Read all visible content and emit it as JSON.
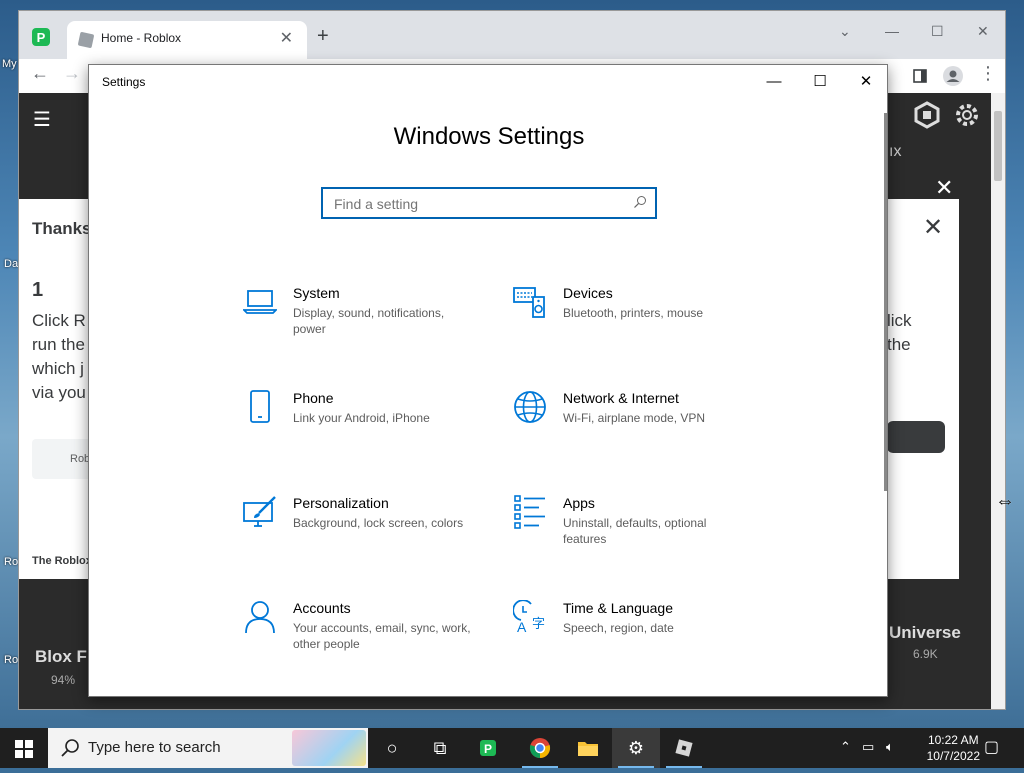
{
  "desktop": {
    "labels": [
      "My",
      "Da",
      "Ro",
      "Ro"
    ]
  },
  "chrome": {
    "tab_title": "Home - Roblox",
    "new_tab": "+",
    "back": "←",
    "forward": "→"
  },
  "roblox_page": {
    "modal_title_partial": "Thanks",
    "step_number": "1",
    "text_lines": [
      "Click R",
      "run the",
      "which j",
      "via you"
    ],
    "right_lines": [
      "lick",
      "the"
    ],
    "roblox_chip": "Robl",
    "footer_partial": "The Roblox",
    "game_title_partial": "Blox F",
    "game_rating_partial": "94%",
    "right_game_title": "Universe",
    "right_game_stat": "6.9K",
    "bx_partial": "ıx"
  },
  "settings": {
    "window_title": "Settings",
    "minimize": "—",
    "maximize": "☐",
    "close": "✕",
    "heading": "Windows Settings",
    "search_placeholder": "Find a setting",
    "items": [
      {
        "title": "System",
        "desc": "Display, sound, notifications, power"
      },
      {
        "title": "Devices",
        "desc": "Bluetooth, printers, mouse"
      },
      {
        "title": "Phone",
        "desc": "Link your Android, iPhone"
      },
      {
        "title": "Network & Internet",
        "desc": "Wi-Fi, airplane mode, VPN"
      },
      {
        "title": "Personalization",
        "desc": "Background, lock screen, colors"
      },
      {
        "title": "Apps",
        "desc": "Uninstall, defaults, optional features"
      },
      {
        "title": "Accounts",
        "desc": "Your accounts, email, sync, work, other people"
      },
      {
        "title": "Time & Language",
        "desc": "Speech, region, date"
      }
    ]
  },
  "taskbar": {
    "search_text": "Type here to search",
    "time": "10:22 AM",
    "date": "10/7/2022"
  },
  "colors": {
    "accent": "#0063b1",
    "icon_blue": "#0078d7"
  }
}
